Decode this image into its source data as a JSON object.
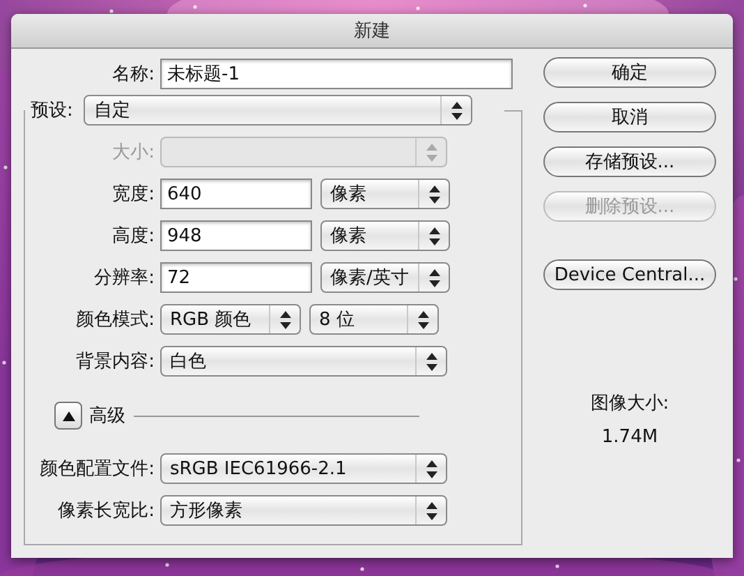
{
  "window": {
    "title": "新建"
  },
  "name": {
    "label": "名称:",
    "value": "未标题-1"
  },
  "preset": {
    "label": "预设:",
    "value": "自定"
  },
  "fields": [
    {
      "kind": "select",
      "label": "大小:",
      "disabled": true
    },
    {
      "kind": "input",
      "label": "宽度:",
      "value": "640",
      "unit": "像素",
      "disabled": false
    },
    {
      "kind": "input",
      "label": "高度:",
      "value": "948",
      "unit": "像素",
      "disabled": false
    },
    {
      "kind": "input",
      "label": "分辨率:",
      "value": "72",
      "unit": "像素/英寸",
      "disabled": false
    },
    {
      "kind": "pair",
      "label": "颜色模式:",
      "value": "RGB 颜色",
      "unit": "8 位",
      "disabled": false
    },
    {
      "kind": "select",
      "label": "背景内容:",
      "value": "白色",
      "disabled": false
    }
  ],
  "advanced": {
    "label": "高级",
    "expanded": true
  },
  "advanced_fields": [
    {
      "label": "颜色配置文件:",
      "value": "sRGB IEC61966-2.1"
    },
    {
      "label": "像素长宽比:",
      "value": "方形像素"
    }
  ],
  "buttons": [
    {
      "label": "确定",
      "disabled": false
    },
    {
      "label": "取消",
      "disabled": false
    },
    {
      "label": "存储预设...",
      "disabled": false
    },
    {
      "label": "删除预设...",
      "disabled": true
    },
    {
      "label": "Device Central...",
      "disabled": false
    }
  ],
  "image_size": {
    "label": "图像大小:",
    "value": "1.74M"
  }
}
